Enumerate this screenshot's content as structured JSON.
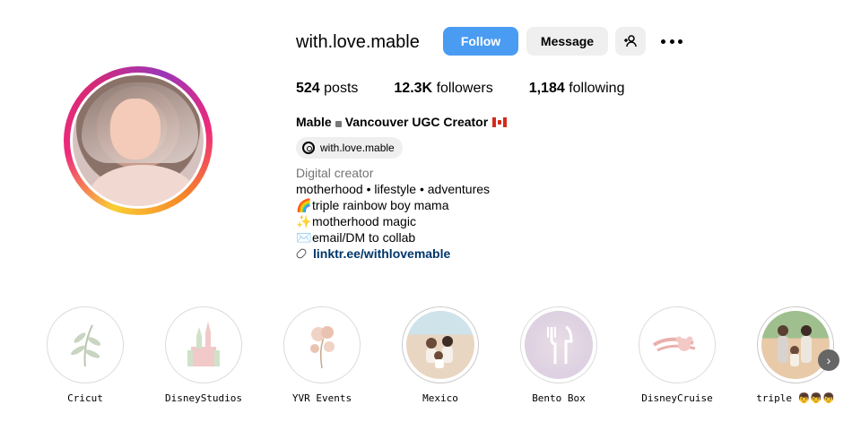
{
  "profile": {
    "username": "with.love.mable",
    "full_name": "Mable",
    "title_suffix": "Vancouver UGC Creator",
    "threads_handle": "with.love.mable",
    "category": "Digital creator",
    "bio_lines": [
      "motherhood • lifestyle • adventures",
      "triple rainbow boy mama",
      "motherhood magic",
      "email/DM to collab"
    ],
    "link": "linktr.ee/withlovemable"
  },
  "actions": {
    "follow": "Follow",
    "message": "Message"
  },
  "stats": {
    "posts_value": "524",
    "posts_label": "posts",
    "followers_value": "12.3K",
    "followers_label": "followers",
    "following_value": "1,184",
    "following_label": "following"
  },
  "highlights": [
    {
      "label": "Cricut"
    },
    {
      "label": "DisneyStudios"
    },
    {
      "label": "YVR Events"
    },
    {
      "label": "Mexico"
    },
    {
      "label": "Bento Box"
    },
    {
      "label": "DisneyCruise"
    },
    {
      "label": "triple 👦👦👦"
    }
  ],
  "colors": {
    "follow_button": "#4a9cf2",
    "link": "#00376b",
    "secondary_button": "#efefef"
  },
  "icons": {
    "add_user": "add-user-icon",
    "more": "more-horizontal-icon",
    "threads": "threads-icon",
    "link": "link-icon",
    "next": "chevron-right-icon"
  }
}
